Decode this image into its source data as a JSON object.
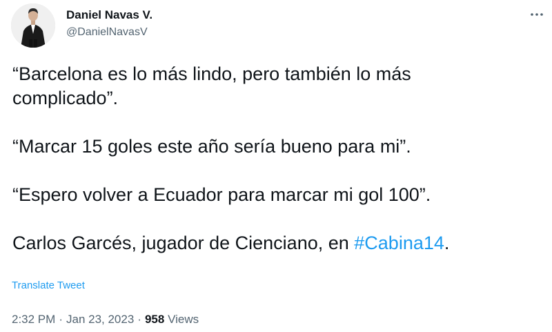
{
  "author": {
    "display_name": "Daniel Navas V.",
    "handle": "@DanielNavasV",
    "avatar_icon": "profile-photo"
  },
  "more_icon": "more-horizontal-icon",
  "tweet": {
    "line_1": "“Barcelona es lo más lindo, pero también lo más",
    "line_2": "complicado”.",
    "line_3": "“Marcar 15 goles este año sería bueno para mi”.",
    "line_4": "“Espero volver a Ecuador para marcar mi gol 100”.",
    "line_5_prefix": "Carlos Garcés, jugador de Cienciano, en ",
    "hashtag": "#Cabina14",
    "line_5_suffix": "."
  },
  "translate_label": "Translate Tweet",
  "meta": {
    "time": "2:32 PM",
    "separator": "·",
    "date": "Jan 23, 2023",
    "views_count": "958",
    "views_label": "Views"
  },
  "colors": {
    "text": "#0f1419",
    "secondary": "#536471",
    "link": "#1d9bf0"
  }
}
